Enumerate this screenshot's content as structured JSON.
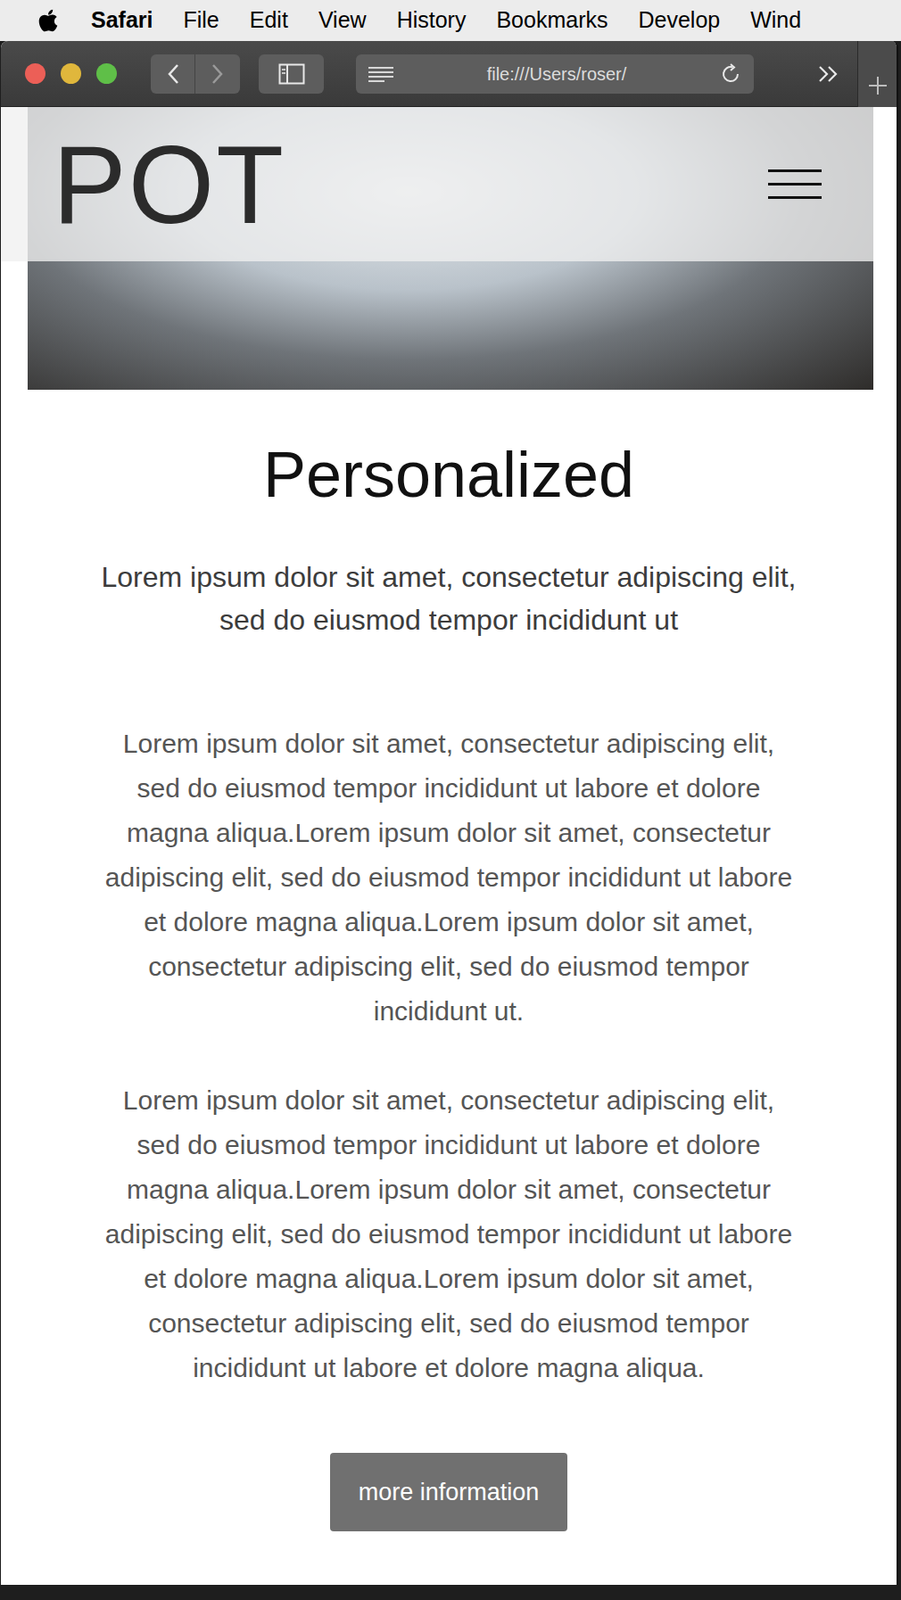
{
  "menu_bar": {
    "app": "Safari",
    "items": [
      "File",
      "Edit",
      "View",
      "History",
      "Bookmarks",
      "Develop",
      "Wind"
    ]
  },
  "toolbar": {
    "address": "file:///Users/roser/"
  },
  "page": {
    "logo": "POT",
    "heading": "Personalized",
    "subtitle": "Lorem ipsum dolor sit amet, consectetur adipiscing elit, sed do eiusmod tempor incididunt ut",
    "paragraphs": [
      "Lorem ipsum dolor sit amet, consectetur adipiscing elit, sed do eiusmod tempor incididunt ut labore et dolore magna aliqua.Lorem ipsum dolor sit amet, consectetur adipiscing elit, sed do eiusmod tempor incididunt ut labore et dolore magna aliqua.Lorem ipsum dolor sit amet, consectetur adipiscing elit, sed do eiusmod tempor incididunt ut.",
      "Lorem ipsum dolor sit amet, consectetur adipiscing elit, sed do eiusmod tempor incididunt ut labore et dolore magna aliqua.Lorem ipsum dolor sit amet, consectetur adipiscing elit, sed do eiusmod tempor incididunt ut labore et dolore magna aliqua.Lorem ipsum dolor sit amet, consectetur adipiscing elit, sed do eiusmod tempor incididunt ut labore et dolore magna aliqua."
    ],
    "button": "more information"
  }
}
